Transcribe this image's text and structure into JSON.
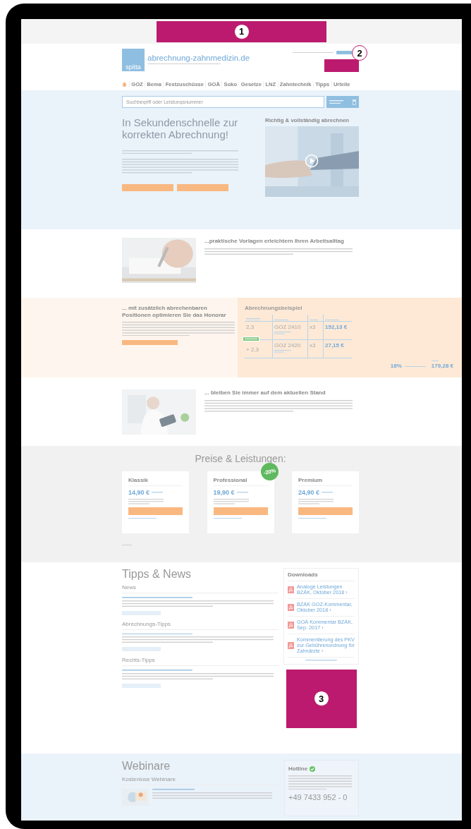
{
  "top_ad": {
    "number": "1"
  },
  "header": {
    "logo": "spitta",
    "site_name": "abrechnung-zahnmedizin.de",
    "ad": {
      "number": "2"
    }
  },
  "nav": [
    "GOZ",
    "Bema",
    "Festzuschüsse",
    "GOÄ",
    "Soko",
    "Gesetze",
    "LNZ",
    "Zahntechnik",
    "Tipps",
    "Urteile"
  ],
  "search": {
    "placeholder": "Suchbegriff oder Leistungsnummer"
  },
  "hero": {
    "title": "In Sekundenschnelle zur korrekten Abrechnung!",
    "video_title": "Richtig & vollständig abrechnen"
  },
  "features": [
    {
      "title": "...praktische Vorlagen erleichtern Ihren Arbeitsalltag"
    },
    {
      "title": "... bleiben Sie immer auf dem aktuellen Stand"
    }
  ],
  "honorar": {
    "title": "... mit zusätzlich abrechenbaren Positionen optimieren Sie das Honorar"
  },
  "example": {
    "title": "Abrechnungsbeispiel",
    "rows": [
      {
        "factor": "2,3",
        "position": "GOZ 2410",
        "quantity": "x3",
        "amount": "152,13 €"
      },
      {
        "factor": "+ 2,3",
        "position": "GOZ 2420",
        "quantity": "x3",
        "amount": "27,15 €"
      }
    ],
    "increase": "18%",
    "total": "179,28 €"
  },
  "pricing": {
    "title": "Preise & Leistungen:",
    "plans": [
      {
        "name": "Klassik",
        "price": "14,90 €"
      },
      {
        "name": "Professional",
        "badge": "-20%",
        "price": "19,90 €"
      },
      {
        "name": "Premium",
        "price": "24,90 €"
      }
    ]
  },
  "tips": {
    "title": "Tipps & News",
    "categories": [
      "News",
      "Abrechnungs-Tipps",
      "Rechts-Tipps"
    ]
  },
  "downloads": {
    "title": "Downloads",
    "items": [
      "Analoge Leistungen BZÄK, Oktober 2018 ›",
      "BZÄK GOZ-Kommentar, Oktober 2018 ›",
      "GOÄ Kommentar BZÄK, Sep. 2017 ›",
      "Kommentierung des PKV zur Gebührenordnung für Zahnärzte ›"
    ]
  },
  "side_ad": {
    "number": "3"
  },
  "webinars": {
    "title": "Webinare",
    "subtitle": "Kostenlose Webinare"
  },
  "hotline": {
    "title": "Hotline",
    "phone": "+49 7433 952 - 0"
  }
}
